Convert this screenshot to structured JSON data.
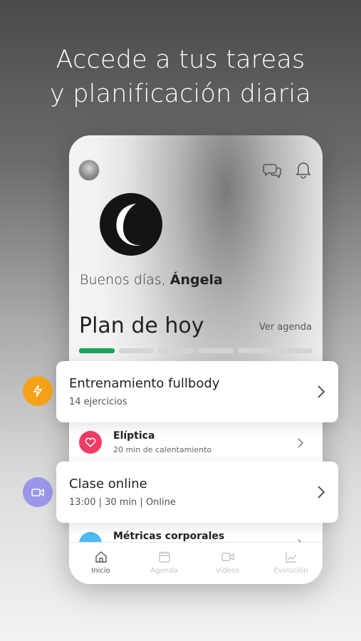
{
  "headline": {
    "line1": "Accede a tus tareas",
    "line2": "y planificación diaria"
  },
  "app": {
    "greeting_prefix": "Buenos días,",
    "greeting_name": "Ángela",
    "plan_title": "Plan de hoy",
    "agenda_link": "Ver agenda",
    "progress": {
      "segments_total": 6,
      "segments_done": 1
    },
    "list": [
      {
        "title": "Elíptica",
        "subtitle": "20 min de calentamiento",
        "icon": "heart-icon",
        "color": "#f03c66"
      },
      {
        "title": "Métricas corporales",
        "icon": "metrics-icon",
        "color": "#4fb9f2"
      }
    ],
    "tabs": [
      {
        "label": "Inicio",
        "icon": "home-icon",
        "active": true
      },
      {
        "label": "Agenda",
        "icon": "calendar-icon",
        "active": false
      },
      {
        "label": "Vídeos",
        "icon": "video-icon",
        "active": false
      },
      {
        "label": "Evolución",
        "icon": "chart-icon",
        "active": false
      }
    ]
  },
  "cards": [
    {
      "title": "Entrenamiento fullbody",
      "subtitle": "14 ejercicios",
      "badge_icon": "lightning-icon",
      "badge_color": "#f5a21a"
    },
    {
      "title": "Clase online",
      "subtitle": "13:00 | 30 min | Online",
      "badge_icon": "video-camera-icon",
      "badge_color": "#9a97e8"
    }
  ],
  "colors": {
    "progress_done": "#1aa15a",
    "progress_pending": "#d4d4d4"
  }
}
